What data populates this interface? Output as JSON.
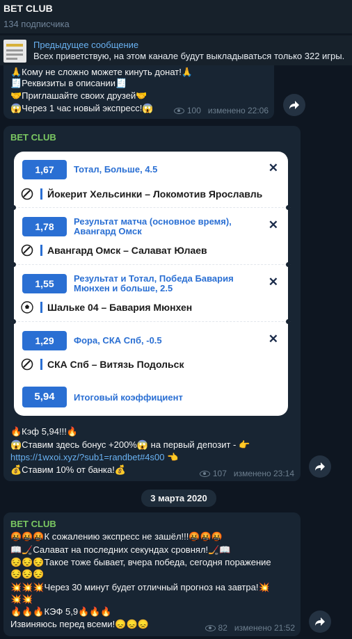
{
  "channel": {
    "title": "BET CLUB",
    "subscribers": "134 подписчика"
  },
  "pinned": {
    "label": "Предыдущее сообщение",
    "text": "Всех приветствую, на этом канале будут выкладываться только 322 игры."
  },
  "msg1": {
    "lines": [
      "🙏Кому не сложно можете кинуть донат!🙏",
      "🧾Реквизиты в описании🧾",
      "🤝Приглашайте своих друзей🤝",
      "😱Через 1 час новый экспресс!😱"
    ],
    "views": "100",
    "edited": "изменено 22:06"
  },
  "msg2": {
    "sender": "BET CLUB",
    "coupon": {
      "bets": [
        {
          "odds": "1,67",
          "market": "Тотал, Больше, 4.5",
          "match": "Йокерит Хельсинки – Локомотив Ярославль",
          "sport": "hockey-puck-icon"
        },
        {
          "odds": "1,78",
          "market": "Результат матча (основное время), Авангард Омск",
          "match": "Авангард Омск – Салават Юлаев",
          "sport": "hockey-puck-icon"
        },
        {
          "odds": "1,55",
          "market": "Результат и Тотал, Победа Бавария Мюнхен и больше, 2.5",
          "match": "Шальке 04 – Бавария Мюнхен",
          "sport": "football-icon"
        },
        {
          "odds": "1,29",
          "market": "Фора, СКА Спб, -0.5",
          "match": "СКА Спб – Витязь Подольск",
          "sport": "hockey-puck-icon"
        }
      ],
      "close_glyph": "✕",
      "total_odds": "5,94",
      "total_label": "Итоговый коэффициент"
    },
    "line1": "🔥Кэф 5,94!!!🔥",
    "line2": "😱Ставим здесь бонус +200%😱 на первый депозит - 👉",
    "link": "https://1wxoi.xyz/?sub1=randbet#4s00",
    "link_suffix": " 👈",
    "line4": "💰Ставим 10% от банка!💰",
    "views": "107",
    "edited": "изменено 23:14"
  },
  "date_separator": "3 марта 2020",
  "msg3": {
    "sender": "BET CLUB",
    "lines": [
      "🤬🤬🤬К сожалению экспресс не зашёл!!!🤬🤬🤬",
      "📖🏒Салават на последних секундах сровнял!🏒📖",
      "😔😔😔Такое тоже бывает, вчера победа, сегодня поражение",
      "😔😔😔",
      "💥💥💥Через 30 минут будет отличный прогноз на завтра!💥",
      "💥💥",
      "🔥🔥🔥КЭФ 5,9🔥🔥🔥",
      "Извиняюсь перед всеми!😞😞😞"
    ],
    "views": "82",
    "edited": "изменено 21:52"
  },
  "colors": {
    "background": "#0e1621",
    "bubble": "#182533",
    "accent": "#6ab2f2",
    "sender": "#7bc862",
    "coupon_blue": "#2a6fd3"
  }
}
